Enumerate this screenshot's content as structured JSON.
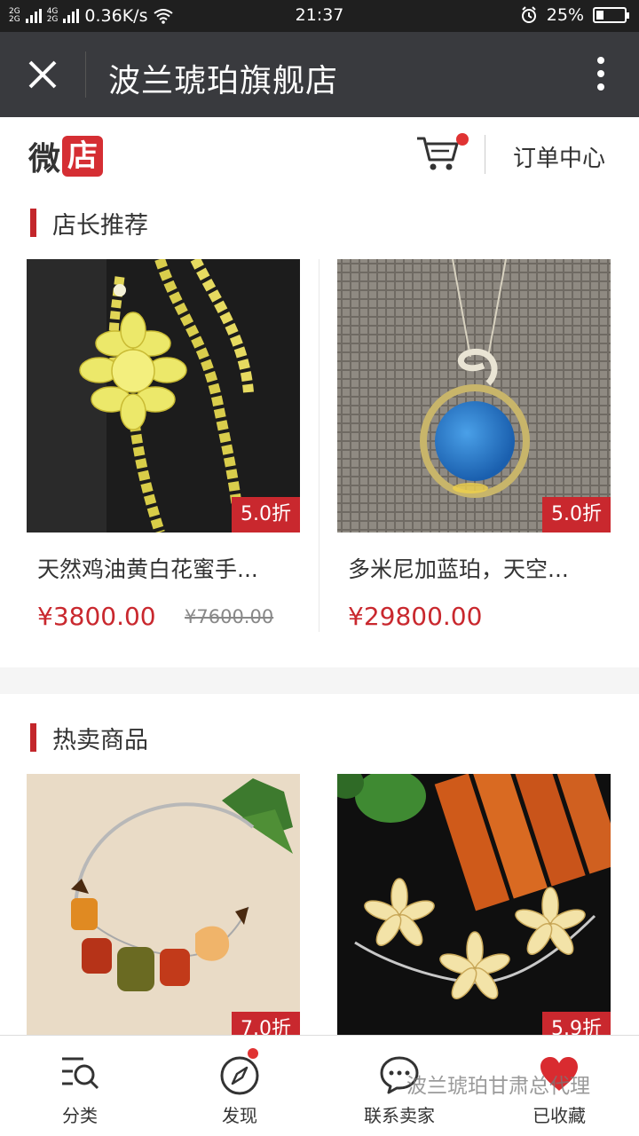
{
  "status_bar": {
    "network_top": "2G",
    "network_bottom": "2G",
    "network_4g": "4G",
    "speed": "0.36K/s",
    "time": "21:37",
    "battery": "25%",
    "battery_level": 0.25
  },
  "titlebar": {
    "title": "波兰琥珀旗舰店",
    "close_icon": "close-icon",
    "more_icon": "more-vertical-icon"
  },
  "store_header": {
    "logo_part1": "微",
    "logo_part2": "店",
    "cart_icon": "cart-icon",
    "orders_label": "订单中心"
  },
  "sections": [
    {
      "title": "店长推荐",
      "products": [
        {
          "name": "天然鸡油黄白花蜜手...",
          "discount": "5.0折",
          "price": "¥3800.00",
          "original_price": "¥7600.00"
        },
        {
          "name": "多米尼加蓝珀，天空...",
          "discount": "5.0折",
          "price": "¥29800.00",
          "original_price": ""
        }
      ]
    },
    {
      "title": "热卖商品",
      "products": [
        {
          "name": "",
          "discount": "7.0折",
          "price": "",
          "original_price": ""
        },
        {
          "name": "",
          "discount": "5.9折",
          "price": "",
          "original_price": ""
        }
      ]
    }
  ],
  "bottom_nav": [
    {
      "label": "分类",
      "icon": "category-search-icon"
    },
    {
      "label": "发现",
      "icon": "compass-icon"
    },
    {
      "label": "联系卖家",
      "icon": "chat-icon"
    },
    {
      "label": "已收藏",
      "icon": "heart-icon"
    }
  ],
  "watermark": "波兰琥珀甘肃总代理",
  "colors": {
    "accent": "#c9282e",
    "titlebar": "#393a3e",
    "statusbar": "#1f1f1f"
  }
}
